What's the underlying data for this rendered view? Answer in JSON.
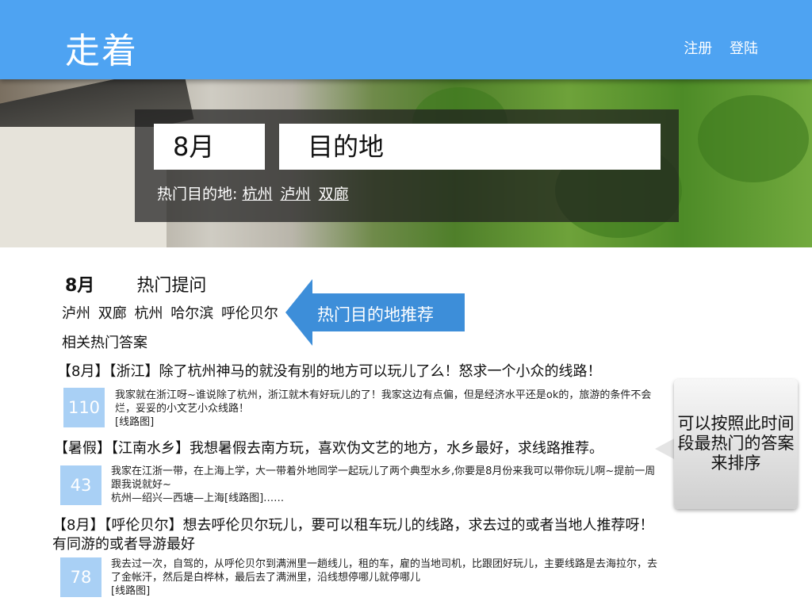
{
  "header": {
    "logo": "走着",
    "register": "注册",
    "login": "登陆"
  },
  "search": {
    "month": "8月",
    "destination": "目的地",
    "hot_label": "热门目的地:",
    "hot_links": [
      "杭州",
      "泸州",
      "双廊"
    ]
  },
  "section": {
    "month": "8月",
    "title": "热门提问",
    "cities": [
      "泸州",
      "双廊",
      "杭州",
      "哈尔滨",
      "呼伦贝尔"
    ],
    "related": "相关热门答案"
  },
  "callouts": {
    "left": "热门目的地推荐",
    "right": "可以按照此时间段最热门的答案来排序"
  },
  "questions": [
    {
      "title": "【8月】【浙江】除了杭州神马的就没有别的地方可以玩儿了么！怒求一个小众的线路！",
      "count": "110",
      "answer": "我家就在浙江呀~谁说除了杭州，浙江就木有好玩儿的了！我家这边有点偏，但是经济水平还是ok的，旅游的条件不会烂，妥妥的小文艺小众线路！\n[线路图]"
    },
    {
      "title": "【暑假】【江南水乡】我想暑假去南方玩，喜欢伪文艺的地方，水乡最好，求线路推荐。",
      "count": "43",
      "answer": "我家在江浙一带，在上海上学，大一带着外地同学一起玩儿了两个典型水乡,你要是8月份来我可以带你玩儿啊~提前一周跟我说就好~\n杭州—绍兴—西塘—上海[线路图]……"
    },
    {
      "title": "【8月】【呼伦贝尔】想去呼伦贝尔玩儿，要可以租车玩儿的线路，求去过的或者当地人推荐呀！有同游的或者导游最好",
      "count": "78",
      "answer": "我去过一次，自驾的，从呼伦贝尔到满洲里一趟线儿，租的车，雇的当地司机，比跟团好玩儿，主要线路是去海拉尔，去了金帐汗，然后是白桦林，最后去了满洲里，沿线想停哪儿就停哪儿\n[线路图]"
    }
  ]
}
